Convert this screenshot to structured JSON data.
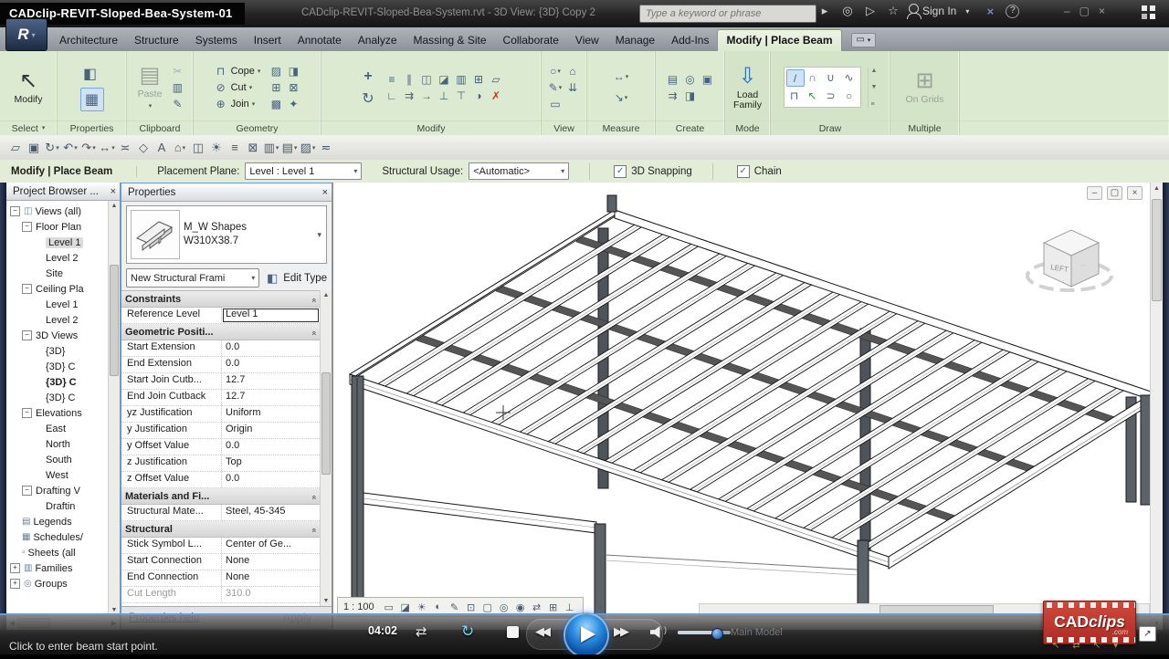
{
  "window": {
    "video_title": "CADclip-REVIT-Sloped-Bea-System-01",
    "app_title": "CADclip-REVIT-Sloped-Bea-System.rvt - 3D View: {3D} Copy 2",
    "search_placeholder": "Type a keyword or phrase",
    "sign_in": "Sign In"
  },
  "colors": {
    "ribbon_context_green": "#dcead2",
    "brand_red": "#b02a22",
    "play_blue": "#0b57ab",
    "selection_blue": "#cfe3f5"
  },
  "tabs": [
    {
      "label": "Architecture"
    },
    {
      "label": "Structure"
    },
    {
      "label": "Systems"
    },
    {
      "label": "Insert"
    },
    {
      "label": "Annotate"
    },
    {
      "label": "Analyze"
    },
    {
      "label": "Massing & Site"
    },
    {
      "label": "Collaborate"
    },
    {
      "label": "View"
    },
    {
      "label": "Manage"
    },
    {
      "label": "Add-Ins"
    },
    {
      "label": "Modify | Place Beam",
      "active": true
    }
  ],
  "ribbon": {
    "select_label": "Select",
    "modify_button": "Modify",
    "properties_label": "Properties",
    "clipboard_label": "Clipboard",
    "paste_button": "Paste",
    "geometry_label": "Geometry",
    "cope_button": "Cope",
    "cut_button": "Cut",
    "join_button": "Join",
    "modify_label": "Modify",
    "view_label": "View",
    "measure_label": "Measure",
    "create_label": "Create",
    "mode_label": "Mode",
    "load_family_button": "Load Family",
    "draw_label": "Draw",
    "multiple_label": "Multiple",
    "on_grids_button": "On Grids"
  },
  "options_bar": {
    "mode_label": "Modify | Place Beam",
    "placement_plane_label": "Placement Plane:",
    "placement_plane_value": "Level : Level 1",
    "structural_usage_label": "Structural Usage:",
    "structural_usage_value": "<Automatic>",
    "checkboxes": [
      {
        "label": "3D Snapping",
        "checked": true
      },
      {
        "label": "Chain",
        "checked": true
      }
    ]
  },
  "project_browser": {
    "title": "Project Browser ...",
    "items": [
      {
        "label": "Views (all)",
        "d": 0,
        "exp": true,
        "icon": "views"
      },
      {
        "label": "Floor Plan",
        "d": 1,
        "exp": true
      },
      {
        "label": "Level 1",
        "d": 2,
        "sel": true
      },
      {
        "label": "Level 2",
        "d": 2
      },
      {
        "label": "Site",
        "d": 2
      },
      {
        "label": "Ceiling Pla",
        "d": 1,
        "exp": true
      },
      {
        "label": "Level 1",
        "d": 2
      },
      {
        "label": "Level 2",
        "d": 2
      },
      {
        "label": "3D Views",
        "d": 1,
        "exp": true
      },
      {
        "label": "{3D}",
        "d": 2
      },
      {
        "label": "{3D} C",
        "d": 2
      },
      {
        "label": "{3D} C",
        "d": 2,
        "bold": true
      },
      {
        "label": "{3D} C",
        "d": 2
      },
      {
        "label": "Elevations",
        "d": 1,
        "exp": true
      },
      {
        "label": "East",
        "d": 2
      },
      {
        "label": "North",
        "d": 2
      },
      {
        "label": "South",
        "d": 2
      },
      {
        "label": "West",
        "d": 2
      },
      {
        "label": "Drafting V",
        "d": 1,
        "exp": true
      },
      {
        "label": "Draftin",
        "d": 2
      },
      {
        "label": "Legends",
        "d": 0,
        "icon": "legends"
      },
      {
        "label": "Schedules/",
        "d": 0,
        "icon": "schedules"
      },
      {
        "label": "Sheets (all",
        "d": 0,
        "icon": "sheets"
      },
      {
        "label": "Families",
        "d": 0,
        "plus": true,
        "icon": "families"
      },
      {
        "label": "Groups",
        "d": 0,
        "plus": true,
        "icon": "groups"
      }
    ]
  },
  "properties": {
    "title": "Properties",
    "type_name": "M_W Shapes",
    "type_size": "W310X38.7",
    "selector_value": "New Structural Frami",
    "edit_type": "Edit Type",
    "sections": [
      {
        "name": "Constraints",
        "rows": [
          {
            "label": "Reference Level",
            "value": "Level 1",
            "editing": true
          }
        ]
      },
      {
        "name": "Geometric Positi...",
        "rows": [
          {
            "label": "Start Extension",
            "value": "0.0"
          },
          {
            "label": "End Extension",
            "value": "0.0"
          },
          {
            "label": "Start Join Cutb...",
            "value": "12.7"
          },
          {
            "label": "End Join Cutback",
            "value": "12.7"
          },
          {
            "label": "yz Justification",
            "value": "Uniform"
          },
          {
            "label": "y Justification",
            "value": "Origin"
          },
          {
            "label": "y Offset Value",
            "value": "0.0"
          },
          {
            "label": "z Justification",
            "value": "Top"
          },
          {
            "label": "z Offset Value",
            "value": "0.0"
          }
        ]
      },
      {
        "name": "Materials and Fi...",
        "rows": [
          {
            "label": "Structural Mate...",
            "value": "Steel, 45-345"
          }
        ]
      },
      {
        "name": "Structural",
        "rows": [
          {
            "label": "Stick Symbol L...",
            "value": "Center of Ge..."
          },
          {
            "label": "Start Connection",
            "value": "None"
          },
          {
            "label": "End Connection",
            "value": "None"
          },
          {
            "label": "Cut Length",
            "value": "310.0",
            "disabled": true
          }
        ]
      }
    ],
    "help_link": "Properties help",
    "apply_button": "Apply"
  },
  "view_bar": {
    "scale": "1 : 100"
  },
  "viewcube": {
    "face_label": "LEFT"
  },
  "player": {
    "time": "04:02"
  },
  "status": {
    "message": "Click to enter beam start point.",
    "main_model": "Main Model"
  },
  "logo": {
    "brand_head": "CAD",
    "brand_tail": "clips",
    "domain": ".com"
  },
  "icons": {
    "caret": "▾",
    "search_go": "▸",
    "binoculars": "◎",
    "subscribe": "▷",
    "star": "☆",
    "close_x": "×",
    "help": "?",
    "win_min": "–",
    "win_restore": "▢",
    "win_close": "×",
    "cursor": "↖",
    "family_types": "◧",
    "prop_palette": "▦",
    "paste": "▤",
    "cope": "⊓",
    "cut_geo": "⊘",
    "join": "⊕",
    "move": "+",
    "rotate": "↻",
    "load_family": "⇩",
    "on_grids": "⊞",
    "edit_type": "◧",
    "minus": "−",
    "plus": "+",
    "chev": "«",
    "views": "◫",
    "legends": "▤",
    "schedules": "▦",
    "sheets": "▫",
    "families": "▥",
    "groups": "◎",
    "shuffle": "⇄",
    "repeat": "↻",
    "rewind": "◀◀",
    "fastforward": "▶▶",
    "expand": "↗",
    "scroll_up": "▲",
    "scroll_dn": "▼",
    "left_ar": "◀",
    "right_ar": "▶"
  },
  "strips": {
    "qat": [
      {
        "n": "open",
        "g": "▱"
      },
      {
        "n": "save",
        "g": "▣"
      },
      {
        "n": "sync",
        "g": "↻",
        "caret": 1
      },
      {
        "n": "undo",
        "g": "↶",
        "caret": 1
      },
      {
        "n": "redo",
        "g": "↷",
        "caret": 1
      },
      {
        "n": "measure",
        "g": "↔",
        "caret": 1
      },
      {
        "n": "aligned-dimension",
        "g": "≍"
      },
      {
        "n": "tag",
        "g": "◇"
      },
      {
        "n": "text",
        "g": "A"
      },
      {
        "n": "default-3d-view",
        "g": "⌂",
        "caret": 1
      },
      {
        "n": "section",
        "g": "◫"
      },
      {
        "n": "sun-path",
        "g": "☀",
        "c": "yel"
      },
      {
        "n": "thin-lines",
        "g": "≡"
      },
      {
        "n": "close-hidden-windows",
        "g": "⊠",
        "c": "red"
      },
      {
        "n": "switch-windows",
        "g": "▥",
        "caret": 1
      },
      {
        "n": "user-interface",
        "g": "▤",
        "caret": 1
      },
      {
        "n": "hatch-region",
        "g": "▨",
        "caret": 1
      },
      {
        "n": "collapse-ribbon",
        "g": "≂"
      }
    ],
    "clipboard_small": [
      {
        "n": "cut-clipboard",
        "g": "✂",
        "c": "dis"
      },
      {
        "n": "copy-clipboard",
        "g": "▥"
      },
      {
        "n": "match-type",
        "g": "✎"
      }
    ],
    "geometry_extra": [
      {
        "n": "wall-opening",
        "g": "▨"
      },
      {
        "n": "beam-opening",
        "g": "◨"
      },
      {
        "n": "offset-small",
        "g": "⊞"
      },
      {
        "n": "unjoin",
        "g": "⊠"
      },
      {
        "n": "slab-edge",
        "g": "▩"
      },
      {
        "n": "demolish-hammer",
        "g": "✦"
      }
    ],
    "modify_grid": [
      {
        "n": "align",
        "g": "≡"
      },
      {
        "n": "offset",
        "g": "∥"
      },
      {
        "n": "mirror-pick-axis",
        "g": "◫"
      },
      {
        "n": "mirror-draw-axis",
        "g": "◪"
      },
      {
        "n": "copy",
        "g": "▥"
      },
      {
        "n": "array",
        "g": "⊞"
      },
      {
        "n": "scale",
        "g": "▱"
      },
      {
        "n": "trim-corner",
        "g": "∟"
      },
      {
        "n": "trim-multiple",
        "g": "⇉"
      },
      {
        "n": "extend",
        "g": "→"
      },
      {
        "n": "pin",
        "g": "⊥"
      },
      {
        "n": "unpin",
        "g": "⊤"
      },
      {
        "n": "split-element",
        "g": "◑"
      },
      {
        "n": "delete",
        "g": "✗",
        "c": "red"
      }
    ],
    "view_icons": [
      {
        "n": "view-lightbulb",
        "g": "○",
        "caret": 1
      },
      {
        "n": "view-house",
        "g": "⌂"
      },
      {
        "n": "view-graphics",
        "g": "✎",
        "caret": 1
      },
      {
        "n": "view-underlay",
        "g": "⇊"
      },
      {
        "n": "view-box",
        "g": "▭"
      }
    ],
    "measure_icons": [
      {
        "n": "measure-between-refs",
        "g": "↔",
        "caret": 1
      },
      {
        "n": "dimension-aligned",
        "g": "↘",
        "caret": 1
      }
    ],
    "create_icons": [
      {
        "n": "create-group",
        "g": "▤"
      },
      {
        "n": "create-similar",
        "g": "◎"
      },
      {
        "n": "load-as-group",
        "g": "▣"
      },
      {
        "n": "create-assembly",
        "g": "⇉"
      },
      {
        "n": "create-parts",
        "g": "◨"
      }
    ],
    "draw_icons": [
      {
        "n": "draw-line",
        "g": "/",
        "c": "sel"
      },
      {
        "n": "draw-arc-three-point",
        "g": "∩"
      },
      {
        "n": "draw-arc-center-ends",
        "g": "∪"
      },
      {
        "n": "draw-spline",
        "g": "∿"
      },
      {
        "n": "draw-partial-ellipse",
        "g": "⊓"
      },
      {
        "n": "draw-pick-lines",
        "g": "↖",
        "c": "grn"
      },
      {
        "n": "draw-tangent-arc",
        "g": "⊃"
      },
      {
        "n": "draw-fillet-arc",
        "g": "○"
      }
    ],
    "viewbar_icons": [
      {
        "n": "detail-level",
        "g": "▭"
      },
      {
        "n": "visual-style",
        "g": "◪"
      },
      {
        "n": "sun-settings",
        "g": "☀",
        "c": "yel"
      },
      {
        "n": "shadows",
        "g": "◐"
      },
      {
        "n": "sketchy-lines",
        "g": "✎"
      },
      {
        "n": "crop-view",
        "g": "⊡"
      },
      {
        "n": "crop-region-visibility",
        "g": "▢"
      },
      {
        "n": "temporary-hide-isolate",
        "g": "◎"
      },
      {
        "n": "reveal-hidden",
        "g": "◉",
        "c": "red"
      },
      {
        "n": "worksharing-display",
        "g": "⇄"
      },
      {
        "n": "analytical-model",
        "g": "⊞"
      },
      {
        "n": "constraints-reveal",
        "g": "⊥"
      }
    ]
  }
}
